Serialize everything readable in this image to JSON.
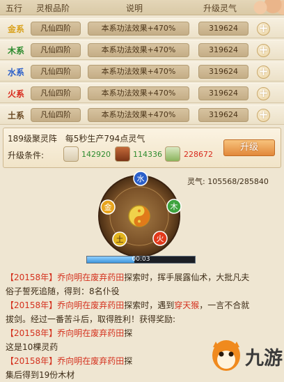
{
  "header": {
    "col_element": "五行",
    "col_grade": "灵根品阶",
    "col_desc": "说明",
    "col_upgrade": "升级灵气"
  },
  "rows": [
    {
      "element": "金系",
      "color": "#d9a11b",
      "grade": "凡仙四阶",
      "effect": "本系功法效果+470%",
      "value": "319624"
    },
    {
      "element": "木系",
      "color": "#2e8b2e",
      "grade": "凡仙四阶",
      "effect": "本系功法效果+470%",
      "value": "319624"
    },
    {
      "element": "水系",
      "color": "#2b5fc9",
      "grade": "凡仙四阶",
      "effect": "本系功法效果+470%",
      "value": "319624"
    },
    {
      "element": "火系",
      "color": "#d8291c",
      "grade": "凡仙四阶",
      "effect": "本系功法效果+470%",
      "value": "319624"
    },
    {
      "element": "土系",
      "color": "#6b4a24",
      "grade": "凡仙四阶",
      "effect": "本系功法效果+470%",
      "value": "319624"
    }
  ],
  "array_panel": {
    "level_name": "189级聚灵阵",
    "production": "每5秒生产794点灵气",
    "condition_label": "升级条件:",
    "costs": [
      {
        "icon": "stone-icon",
        "value": "142920",
        "color": "#2e8b2e"
      },
      {
        "icon": "wood-icon",
        "value": "114336",
        "color": "#2e8b2e"
      },
      {
        "icon": "herb-icon",
        "value": "228672",
        "color": "#d8291c"
      }
    ],
    "upgrade_button": "升级"
  },
  "qi": {
    "label": "灵气:",
    "value": "105568/285840",
    "progress_fraction": 0.369
  },
  "wheel": {
    "elements": [
      "水",
      "木",
      "火",
      "土",
      "金"
    ],
    "progress_text": "00:03",
    "progress_fraction": 0.44
  },
  "log": {
    "entries": [
      {
        "year": "【20158年】",
        "text1": "乔向明在",
        "place": "废弃药田",
        "text2": "探索时，挥手展露仙术，大批凡夫",
        "cont": "俗子誓死追随，得到：8名仆役"
      },
      {
        "year": "【20158年】",
        "text1": "乔向明在",
        "place": "废弃药田",
        "text2": "探索时，遇到",
        "monster": "穿天猴",
        "text3": "，一言不合就",
        "cont": "拔剑。经过一番苦斗后，取得胜利！获得奖励:"
      },
      {
        "year": "【20158年】",
        "text1": "乔向明在",
        "place": "废弃药田",
        "text2": "探",
        "cont": "这是10棵灵药"
      },
      {
        "year": "【20158年】",
        "text1": "乔向明在",
        "place": "废弃药田",
        "text2": "探",
        "cont": "集后得到19份木材"
      }
    ]
  },
  "watermark": {
    "text": "九游"
  }
}
